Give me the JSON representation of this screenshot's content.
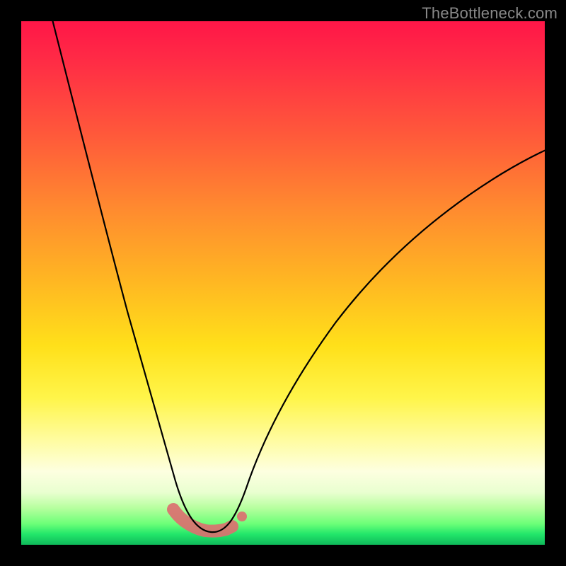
{
  "watermark": "TheBottleneck.com",
  "chart_data": {
    "type": "line",
    "title": "",
    "xlabel": "",
    "ylabel": "",
    "xlim": [
      0,
      100
    ],
    "ylim": [
      0,
      100
    ],
    "gradient_stops": [
      {
        "pct": 0,
        "color": "#ff1648"
      },
      {
        "pct": 50,
        "color": "#ffb822"
      },
      {
        "pct": 80,
        "color": "#fffca0"
      },
      {
        "pct": 100,
        "color": "#0fb95a"
      }
    ],
    "series": [
      {
        "name": "bottleneck-curve",
        "x": [
          6,
          10,
          14,
          18,
          22,
          26,
          28,
          30,
          32,
          33,
          34,
          35,
          36,
          38,
          40,
          42,
          46,
          52,
          60,
          70,
          82,
          95,
          100
        ],
        "y": [
          100,
          88,
          75,
          62,
          48,
          32,
          24,
          16,
          9,
          6,
          4,
          3,
          3,
          3,
          4,
          6,
          11,
          19,
          30,
          42,
          54,
          65,
          69
        ]
      }
    ],
    "highlight": {
      "name": "optimal-range",
      "x": [
        30,
        31,
        32,
        33,
        34,
        35,
        36,
        37,
        38,
        39
      ],
      "y": [
        8,
        6,
        5,
        4,
        3,
        3,
        3,
        4,
        4,
        5
      ],
      "dot": {
        "x": 41,
        "y": 7
      }
    }
  }
}
